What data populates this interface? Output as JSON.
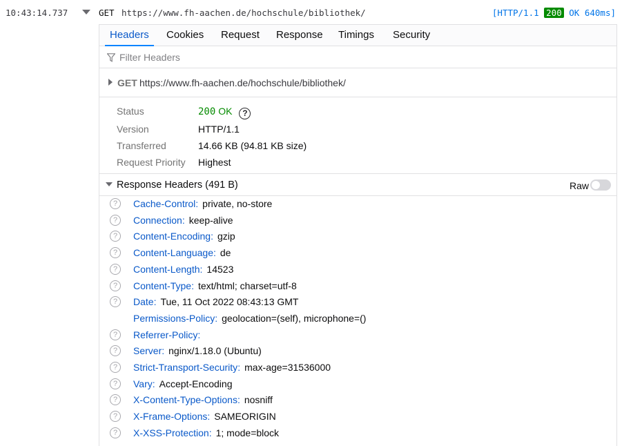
{
  "request": {
    "timestamp": "10:43:14.737",
    "method": "GET",
    "url": "https://www.fh-aachen.de/hochschule/bibliothek/",
    "summary_prefix": "[HTTP/1.1 ",
    "status_code": "200",
    "summary_suffix": " OK 640ms]"
  },
  "tabs": [
    "Headers",
    "Cookies",
    "Request",
    "Response",
    "Timings",
    "Security"
  ],
  "active_tab": "Headers",
  "filter": {
    "placeholder": "Filter Headers"
  },
  "url_row": {
    "method": "GET",
    "url": "https://www.fh-aachen.de/hochschule/bibliothek/"
  },
  "status": {
    "status_label": "Status",
    "status_code": "200",
    "status_text": "OK",
    "version_label": "Version",
    "version_value": "HTTP/1.1",
    "transferred_label": "Transferred",
    "transferred_value": "14.66 KB (94.81 KB size)",
    "priority_label": "Request Priority",
    "priority_value": "Highest"
  },
  "response_headers": {
    "title": "Response Headers (491 B)",
    "raw_label": "Raw",
    "raw_enabled": false,
    "items": [
      {
        "name": "Cache-Control",
        "value": "private, no-store",
        "help": true
      },
      {
        "name": "Connection",
        "value": "keep-alive",
        "help": true
      },
      {
        "name": "Content-Encoding",
        "value": "gzip",
        "help": true
      },
      {
        "name": "Content-Language",
        "value": "de",
        "help": true
      },
      {
        "name": "Content-Length",
        "value": "14523",
        "help": true
      },
      {
        "name": "Content-Type",
        "value": "text/html; charset=utf-8",
        "help": true
      },
      {
        "name": "Date",
        "value": "Tue, 11 Oct 2022 08:43:13 GMT",
        "help": true
      },
      {
        "name": "Permissions-Policy",
        "value": "geolocation=(self), microphone=()",
        "help": false
      },
      {
        "name": "Referrer-Policy",
        "value": "",
        "help": true
      },
      {
        "name": "Server",
        "value": "nginx/1.18.0 (Ubuntu)",
        "help": true
      },
      {
        "name": "Strict-Transport-Security",
        "value": "max-age=31536000",
        "help": true
      },
      {
        "name": "Vary",
        "value": "Accept-Encoding",
        "help": true
      },
      {
        "name": "X-Content-Type-Options",
        "value": "nosniff",
        "help": true
      },
      {
        "name": "X-Frame-Options",
        "value": "SAMEORIGIN",
        "help": true
      },
      {
        "name": "X-XSS-Protection",
        "value": "1; mode=block",
        "help": true
      }
    ]
  },
  "colors": {
    "accent": "#0a84ff",
    "header_name": "#0a59c9",
    "status_ok": "#058b00"
  }
}
